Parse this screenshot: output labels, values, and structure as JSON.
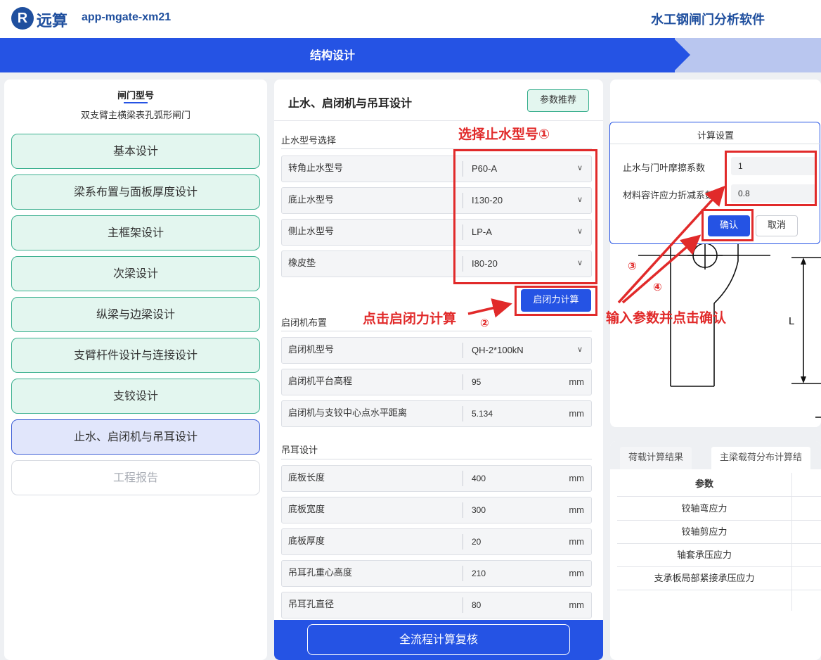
{
  "header": {
    "logo_mark": "R",
    "logo_text": "远算",
    "app_id": "app-mgate-xm21",
    "software_title": "水工钢闸门分析软件"
  },
  "stepbar": {
    "active_step": "结构设计"
  },
  "left": {
    "gate_type_heading": "闸门型号",
    "gate_type_value": "双支臂主横梁表孔弧形闸门",
    "nav": [
      "基本设计",
      "梁系布置与面板厚度设计",
      "主框架设计",
      "次梁设计",
      "纵梁与边梁设计",
      "支臂杆件设计与连接设计",
      "支铰设计",
      "止水、启闭机与吊耳设计",
      "工程报告"
    ]
  },
  "middle": {
    "title": "止水、启闭机与吊耳设计",
    "recommend_label": "参数推荐",
    "seal_section": "止水型号选择",
    "seal_rows": [
      {
        "label": "转角止水型号",
        "value": "P60-A"
      },
      {
        "label": "底止水型号",
        "value": "I130-20"
      },
      {
        "label": "侧止水型号",
        "value": "LP-A"
      },
      {
        "label": "橡皮垫",
        "value": "I80-20"
      }
    ],
    "calc_button": "启闭力计算",
    "hoist_section": "启闭机布置",
    "hoist_rows": [
      {
        "label": "启闭机型号",
        "value": "QH-2*100kN",
        "unit": ""
      },
      {
        "label": "启闭机平台高程",
        "value": "95",
        "unit": "mm"
      },
      {
        "label": "启闭机与支铰中心点水平距离",
        "value": "5.134",
        "unit": "mm"
      }
    ],
    "lug_section": "吊耳设计",
    "lug_rows": [
      {
        "label": "底板长度",
        "value": "400",
        "unit": "mm"
      },
      {
        "label": "底板宽度",
        "value": "300",
        "unit": "mm"
      },
      {
        "label": "底板厚度",
        "value": "20",
        "unit": "mm"
      },
      {
        "label": "吊耳孔重心高度",
        "value": "210",
        "unit": "mm"
      },
      {
        "label": "吊耳孔直径",
        "value": "80",
        "unit": "mm"
      }
    ],
    "full_check_button": "全流程计算复核"
  },
  "dialog": {
    "title": "计算设置",
    "friction_label": "止水与门叶摩擦系数",
    "friction_value": "1",
    "reduction_label": "材料容许应力折减系数",
    "reduction_value": "0.8",
    "confirm": "确认",
    "cancel": "取消"
  },
  "drawing": {
    "dimension_label": "L"
  },
  "results": {
    "tabs": [
      "荷载计算结果",
      "主梁载荷分布计算结"
    ],
    "column_header": "参数",
    "rows": [
      "铰轴弯应力",
      "铰轴剪应力",
      "轴套承压应力",
      "支承板局部紧接承压应力"
    ]
  },
  "annotations": {
    "select_seal": "选择止水型号①",
    "click_calc": "点击启闭力计算",
    "num_2": "②",
    "input_confirm": "输入参数并点击确认",
    "num_3": "③",
    "num_4": "④"
  },
  "colors": {
    "primary": "#2553e4",
    "nav_green_bg": "#e3f6ef",
    "nav_green_border": "#3bb08f",
    "annotation_red": "#e12a2a"
  }
}
